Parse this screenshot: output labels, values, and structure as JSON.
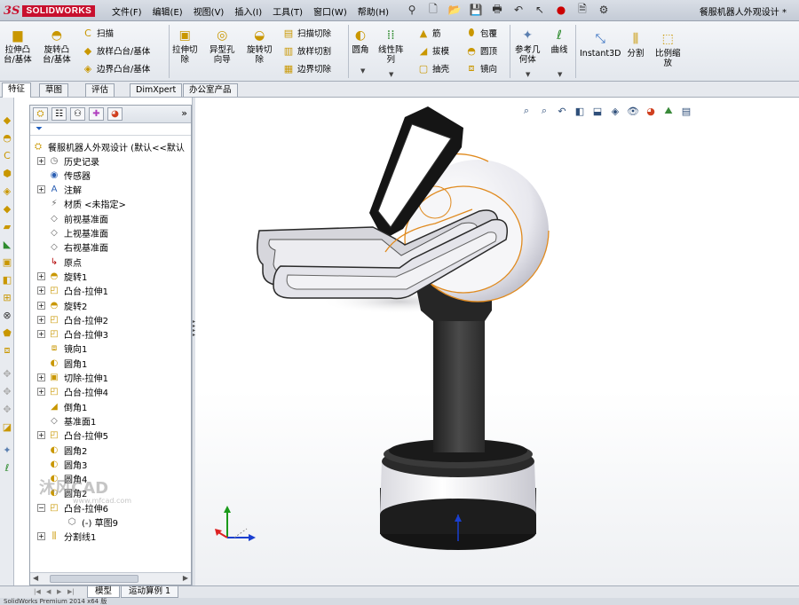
{
  "titlebar": {
    "logo_ds": "3S",
    "logo_text": "SOLIDWORKS",
    "menus": [
      "文件(F)",
      "编辑(E)",
      "视图(V)",
      "插入(I)",
      "工具(T)",
      "窗口(W)",
      "帮助(H)"
    ],
    "document_title": "餐服机器人外观设计 *"
  },
  "ribbon": {
    "extrude_boss": "拉伸凸\n台/基体",
    "revolve_boss": "旋转凸\n台/基体",
    "sweep": "扫描",
    "loft_boss": "放样凸台/基体",
    "boundary_boss": "边界凸台/基体",
    "extrude_cut": "拉伸切\n除",
    "hole_wizard": "异型孔\n向导",
    "revolve_cut": "旋转切\n除",
    "sweep_cut": "扫描切除",
    "loft_cut": "放样切割",
    "boundary_cut": "边界切除",
    "fillet": "圆角",
    "linear_pattern": "线性阵\n列",
    "rib": "筋",
    "draft": "拔模",
    "shell": "抽壳",
    "wrap": "包覆",
    "dome": "圆顶",
    "mirror": "镜向",
    "ref_geometry": "参考几\n何体",
    "curves": "曲线",
    "instant3d": "Instant3D",
    "split": "分割",
    "scale": "比例缩\n放"
  },
  "tabs": [
    "特征",
    "草图",
    "评估",
    "DimXpert",
    "办公室产品"
  ],
  "feature_tree": {
    "root": "餐服机器人外观设计 (默认<<默认",
    "items": [
      {
        "label": "历史记录",
        "icon": "history-icon",
        "expand": true
      },
      {
        "label": "传感器",
        "icon": "sensor-icon",
        "expand": false
      },
      {
        "label": "注解",
        "icon": "annotation-icon",
        "expand": true
      },
      {
        "label": "材质 <未指定>",
        "icon": "material-icon",
        "expand": false
      },
      {
        "label": "前视基准面",
        "icon": "plane-icon",
        "expand": false
      },
      {
        "label": "上视基准面",
        "icon": "plane-icon",
        "expand": false
      },
      {
        "label": "右视基准面",
        "icon": "plane-icon",
        "expand": false
      },
      {
        "label": "原点",
        "icon": "origin-icon",
        "expand": false
      },
      {
        "label": "旋转1",
        "icon": "revolve-icon",
        "expand": true
      },
      {
        "label": "凸台-拉伸1",
        "icon": "extrude-icon",
        "expand": true
      },
      {
        "label": "旋转2",
        "icon": "revolve-icon",
        "expand": true
      },
      {
        "label": "凸台-拉伸2",
        "icon": "extrude-icon",
        "expand": true
      },
      {
        "label": "凸台-拉伸3",
        "icon": "extrude-icon",
        "expand": true
      },
      {
        "label": "镜向1",
        "icon": "mirror-icon",
        "expand": false
      },
      {
        "label": "圆角1",
        "icon": "fillet-icon",
        "expand": false
      },
      {
        "label": "切除-拉伸1",
        "icon": "cut-extrude-icon",
        "expand": true
      },
      {
        "label": "凸台-拉伸4",
        "icon": "extrude-icon",
        "expand": true
      },
      {
        "label": "倒角1",
        "icon": "chamfer-icon",
        "expand": false
      },
      {
        "label": "基准面1",
        "icon": "plane-icon",
        "expand": false
      },
      {
        "label": "凸台-拉伸5",
        "icon": "extrude-icon",
        "expand": true
      },
      {
        "label": "圆角2",
        "icon": "fillet-icon",
        "expand": false
      },
      {
        "label": "圆角3",
        "icon": "fillet-icon",
        "expand": false
      },
      {
        "label": "圆角4",
        "icon": "fillet-icon",
        "expand": false
      },
      {
        "label": "圆角2",
        "icon": "fillet-icon",
        "expand": false
      },
      {
        "label": "凸台-拉伸6",
        "icon": "extrude-icon",
        "expand": "open"
      },
      {
        "label": "(-) 草图9",
        "icon": "sketch-icon",
        "expand": false,
        "child": true
      },
      {
        "label": "分割线1",
        "icon": "split-line-icon",
        "expand": true
      }
    ]
  },
  "bottom_tabs": [
    "模型",
    "运动算例 1"
  ],
  "status": "SolidWorks Premium 2014 x64 版",
  "watermark": {
    "main": "沐风CAD",
    "url": "www.mfcad.com"
  },
  "colors": {
    "selection_orange": "#e08a1e",
    "body_gray": "#3c3c3c",
    "shell_white": "#f4f4f6",
    "axis_red": "#d22",
    "axis_green": "#1a9a1a",
    "axis_blue": "#1a3fd0"
  }
}
